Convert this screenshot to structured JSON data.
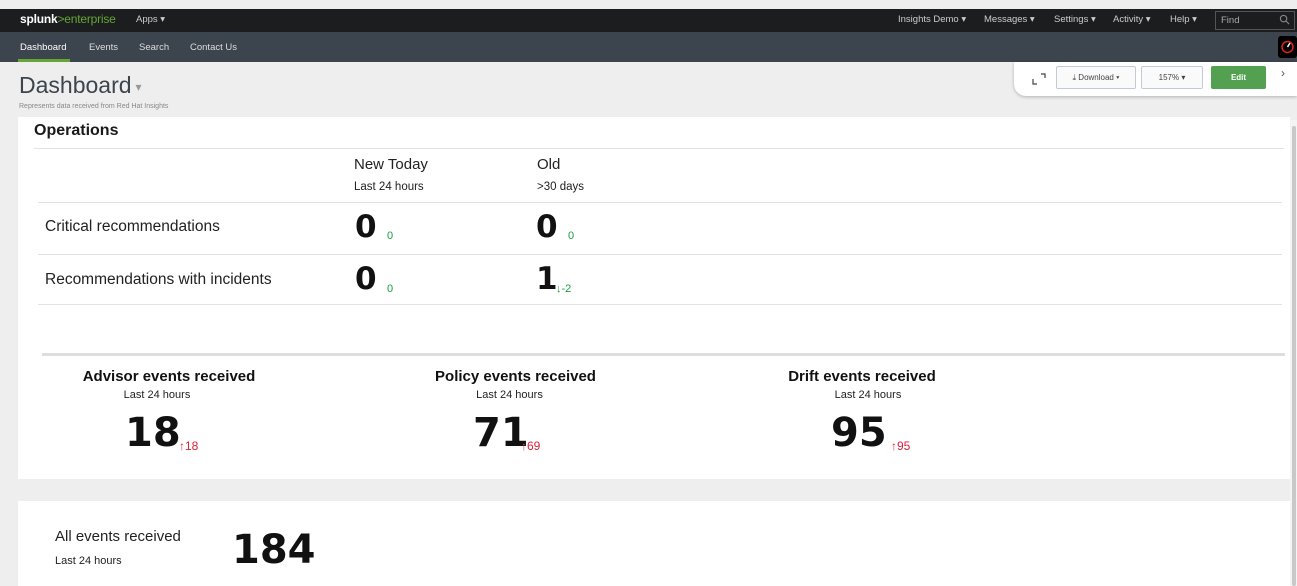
{
  "topbar": {
    "logo_main": "splunk",
    "logo_gt": ">",
    "logo_product": "enterprise",
    "apps": "Apps ▾",
    "nav": [
      "Insights Demo ▾",
      "Messages ▾",
      "Settings ▾",
      "Activity ▾",
      "Help ▾"
    ],
    "find_placeholder": "Find"
  },
  "appbar": {
    "items": [
      "Dashboard",
      "Events",
      "Search",
      "Contact Us"
    ]
  },
  "header": {
    "title": "Dashboard",
    "caret": "▾",
    "description": "Represents data received from Red Hat Insights"
  },
  "toolbar": {
    "download": "⤓ Download ▾",
    "zoom": "157%  ▾",
    "edit": "Edit",
    "more": "›"
  },
  "operations": {
    "title": "Operations",
    "columns": [
      {
        "head": "New Today",
        "sub": "Last 24 hours"
      },
      {
        "head": "Old",
        "sub": ">30 days"
      }
    ],
    "rows": [
      {
        "label": "Critical recommendations",
        "new_value": "0",
        "new_delta": "0",
        "old_value": "0",
        "old_delta": "0"
      },
      {
        "label": "Recommendations with incidents",
        "new_value": "0",
        "new_delta": "0",
        "old_value": "1",
        "old_delta": "↓-2"
      }
    ]
  },
  "events": [
    {
      "title": "Advisor events received",
      "sub": "Last 24 hours",
      "value": "18",
      "delta": "↑18"
    },
    {
      "title": "Policy events received",
      "sub": "Last 24 hours",
      "value": "71",
      "delta": "↑69"
    },
    {
      "title": "Drift events received",
      "sub": "Last 24 hours",
      "value": "95",
      "delta": "↑95"
    }
  ],
  "all_events": {
    "title": "All events received",
    "sub": "Last 24 hours",
    "value": "184"
  },
  "colors": {
    "accent_green": "#65a637",
    "delta_up": "#d6223a",
    "delta_neutral": "#1a9c3e",
    "edit_button": "#53a051"
  }
}
